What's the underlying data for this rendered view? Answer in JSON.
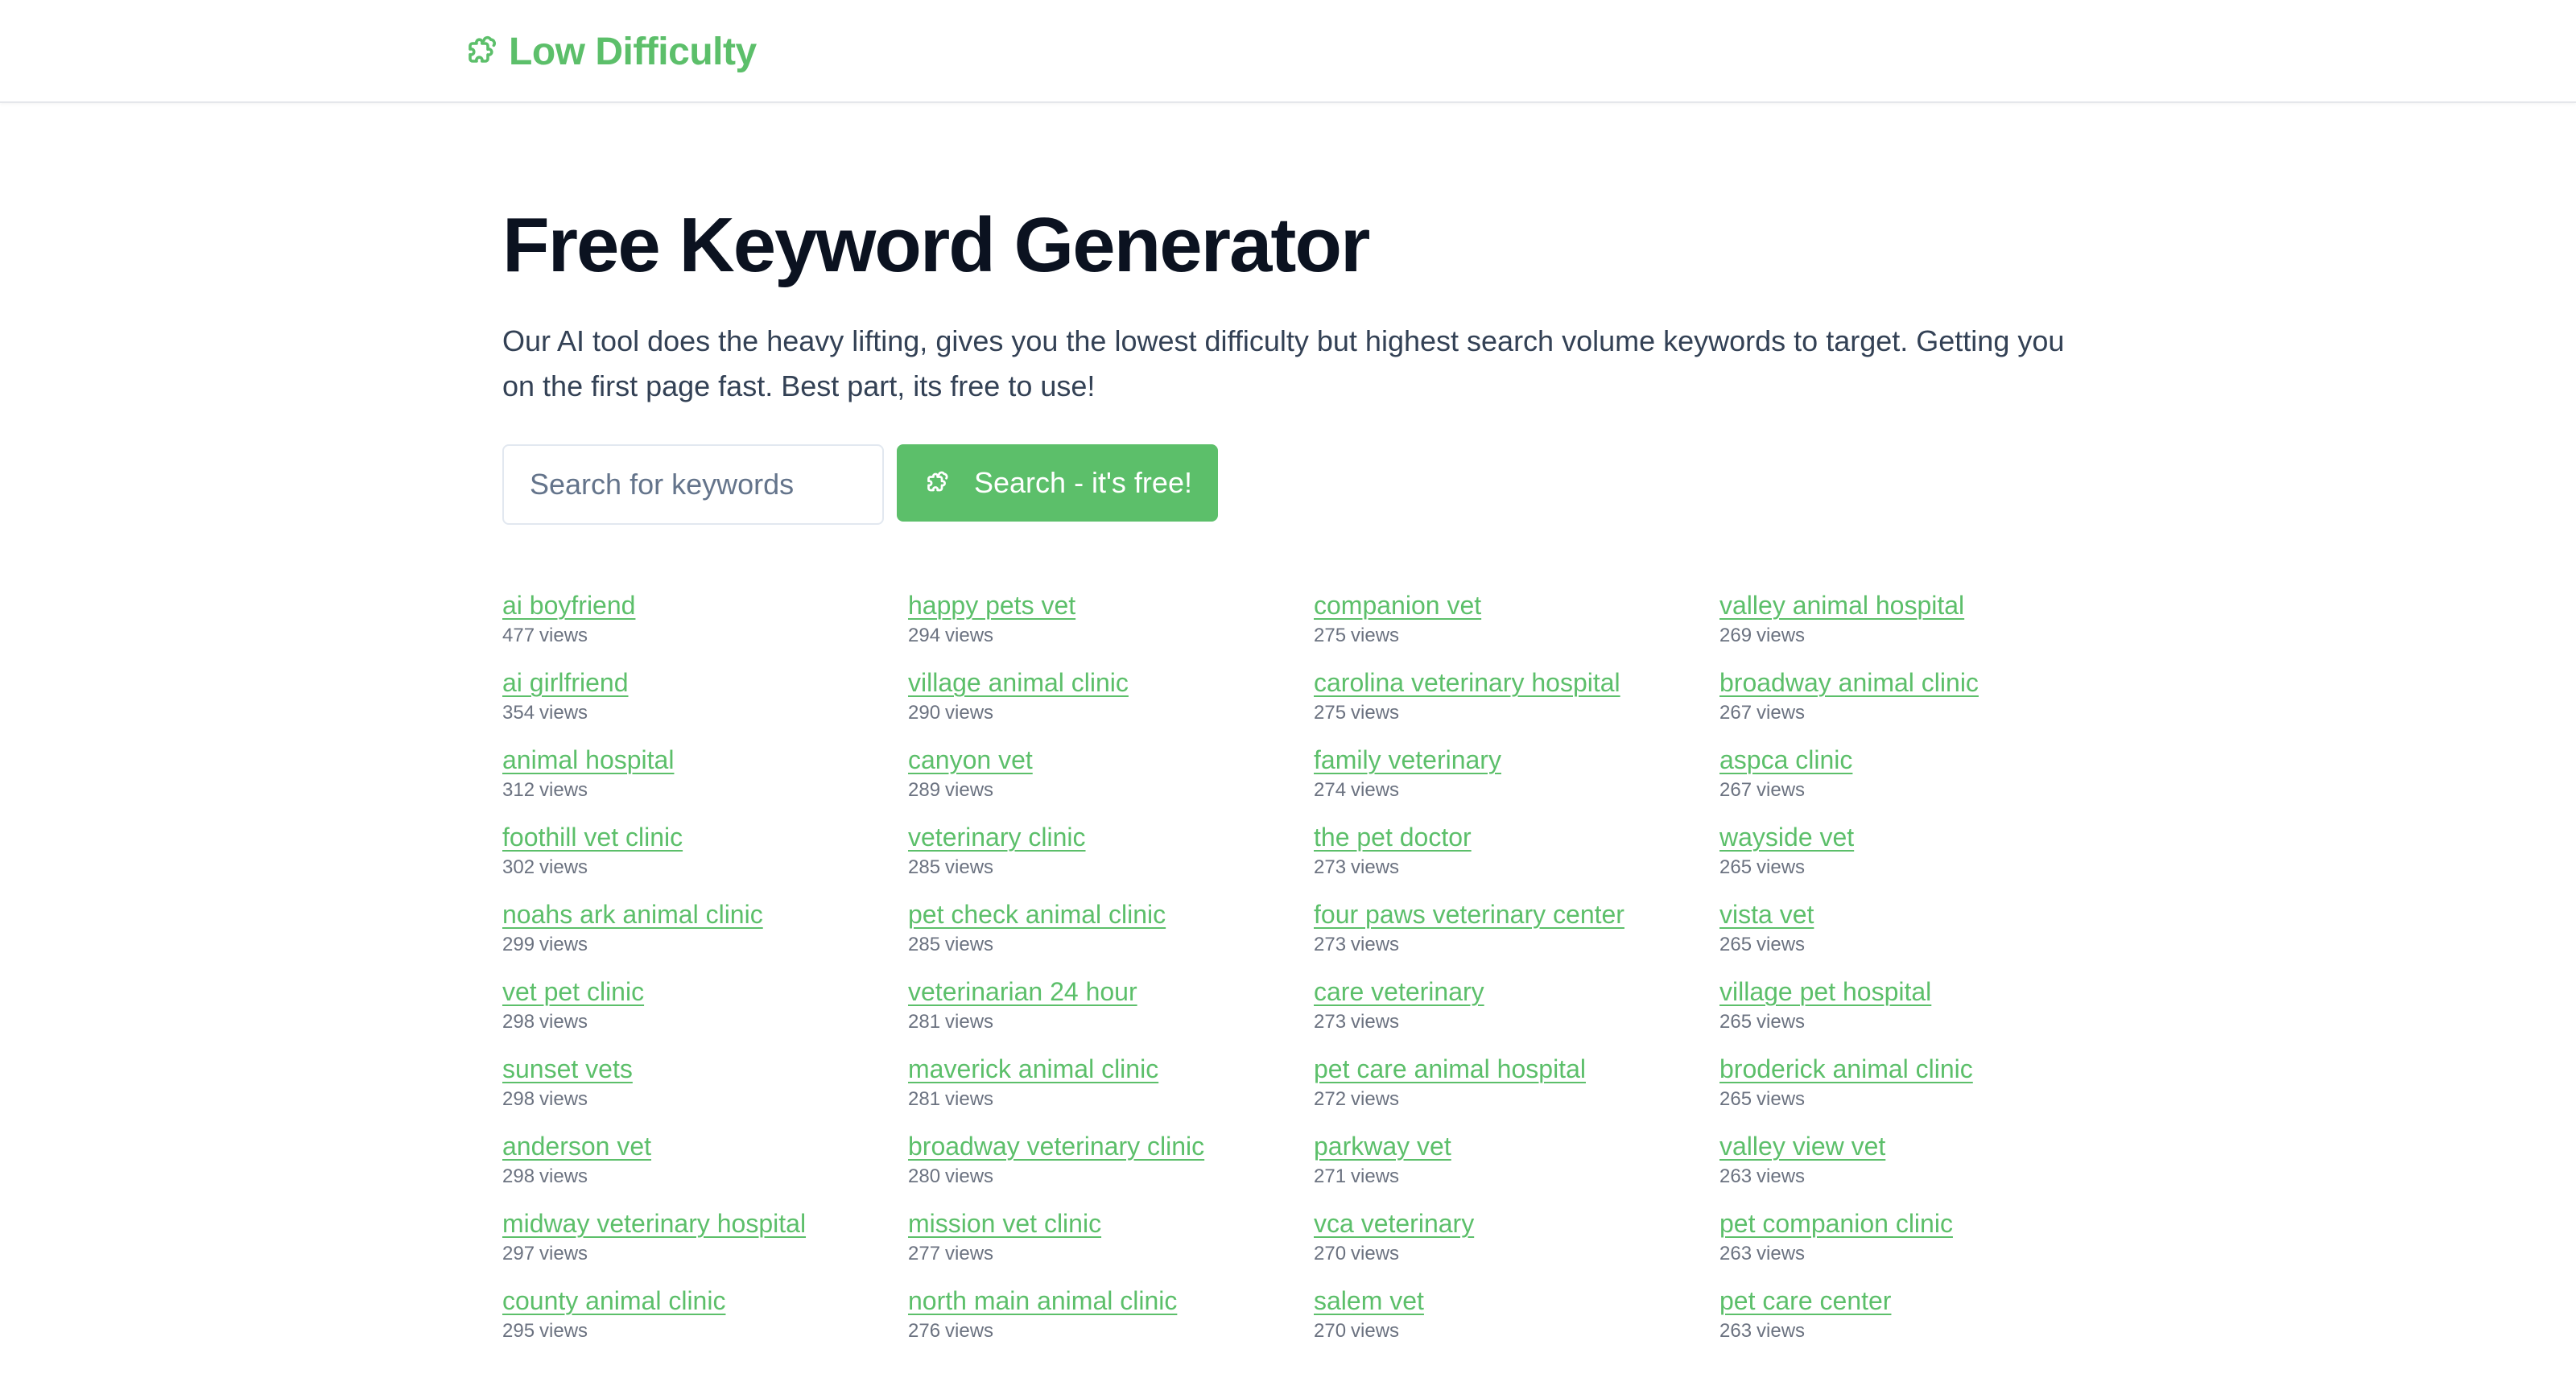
{
  "brand": {
    "name": "Low Difficulty",
    "icon": "puzzle-piece-icon",
    "color": "#5cbf6a"
  },
  "hero": {
    "title": "Free Keyword Generator",
    "subtitle": "Our AI tool does the heavy lifting, gives you the lowest difficulty but highest search volume keywords to target. Getting you on the first page fast. Best part, its free to use!"
  },
  "search": {
    "placeholder": "Search for keywords",
    "value": "",
    "button_label": "Search - it's free!",
    "button_icon": "puzzle-piece-icon"
  },
  "views_unit": "views",
  "keywords": [
    {
      "term": "ai boyfriend",
      "views": "477"
    },
    {
      "term": "ai girlfriend",
      "views": "354"
    },
    {
      "term": "animal hospital",
      "views": "312"
    },
    {
      "term": "foothill vet clinic",
      "views": "302"
    },
    {
      "term": "noahs ark animal clinic",
      "views": "299"
    },
    {
      "term": "vet pet clinic",
      "views": "298"
    },
    {
      "term": "sunset vets",
      "views": "298"
    },
    {
      "term": "anderson vet",
      "views": "298"
    },
    {
      "term": "midway veterinary hospital",
      "views": "297"
    },
    {
      "term": "county animal clinic",
      "views": "295"
    },
    {
      "term": "happy pets vet",
      "views": "294"
    },
    {
      "term": "village animal clinic",
      "views": "290"
    },
    {
      "term": "canyon vet",
      "views": "289"
    },
    {
      "term": "veterinary clinic",
      "views": "285"
    },
    {
      "term": "pet check animal clinic",
      "views": "285"
    },
    {
      "term": "veterinarian 24 hour",
      "views": "281"
    },
    {
      "term": "maverick animal clinic",
      "views": "281"
    },
    {
      "term": "broadway veterinary clinic",
      "views": "280"
    },
    {
      "term": "mission vet clinic",
      "views": "277"
    },
    {
      "term": "north main animal clinic",
      "views": "276"
    },
    {
      "term": "companion vet",
      "views": "275"
    },
    {
      "term": "carolina veterinary hospital",
      "views": "275"
    },
    {
      "term": "family veterinary",
      "views": "274"
    },
    {
      "term": "the pet doctor",
      "views": "273"
    },
    {
      "term": "four paws veterinary center",
      "views": "273"
    },
    {
      "term": "care veterinary",
      "views": "273"
    },
    {
      "term": "pet care animal hospital",
      "views": "272"
    },
    {
      "term": "parkway vet",
      "views": "271"
    },
    {
      "term": "vca veterinary",
      "views": "270"
    },
    {
      "term": "salem vet",
      "views": "270"
    },
    {
      "term": "valley animal hospital",
      "views": "269"
    },
    {
      "term": "broadway animal clinic",
      "views": "267"
    },
    {
      "term": "aspca clinic",
      "views": "267"
    },
    {
      "term": "wayside vet",
      "views": "265"
    },
    {
      "term": "vista vet",
      "views": "265"
    },
    {
      "term": "village pet hospital",
      "views": "265"
    },
    {
      "term": "broderick animal clinic",
      "views": "265"
    },
    {
      "term": "valley view vet",
      "views": "263"
    },
    {
      "term": "pet companion clinic",
      "views": "263"
    },
    {
      "term": "pet care center",
      "views": "263"
    }
  ]
}
